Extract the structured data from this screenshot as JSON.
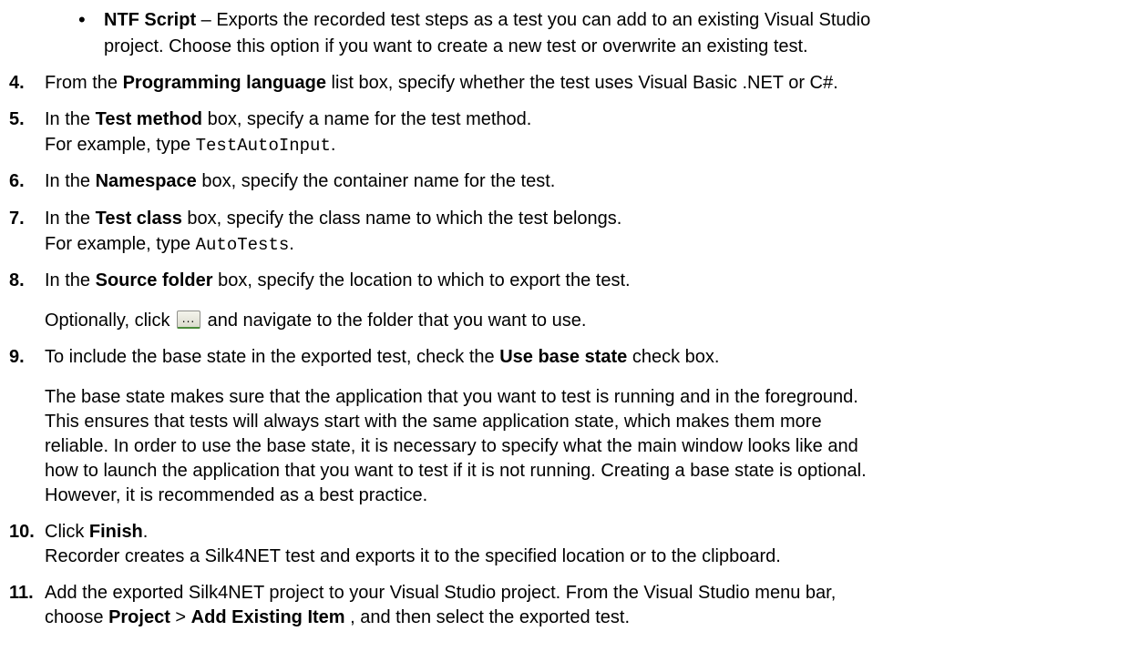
{
  "bullet": {
    "symbol": "•",
    "title": "NTF Script",
    "text1": " – Exports the recorded test steps as a test you can add to an existing Visual Studio",
    "text2": "project. Choose this option if you want to create a new test or overwrite an existing test."
  },
  "step4": {
    "num": "4.",
    "pre": "From the ",
    "bold": "Programming language",
    "post": " list box, specify whether the test uses Visual Basic .NET or C#."
  },
  "step5": {
    "num": "5.",
    "pre": "In the ",
    "bold": "Test method",
    "post": " box, specify a name for the test method.",
    "ex_pre": "For example, type ",
    "ex_code": "TestAutoInput",
    "ex_post": "."
  },
  "step6": {
    "num": "6.",
    "pre": "In the ",
    "bold": "Namespace",
    "post": " box, specify the container name for the test."
  },
  "step7": {
    "num": "7.",
    "pre": "In the ",
    "bold": "Test class",
    "post": " box, specify the class name to which the test belongs.",
    "ex_pre": "For example, type ",
    "ex_code": "AutoTests",
    "ex_post": "."
  },
  "step8": {
    "num": "8.",
    "pre": "In the ",
    "bold": "Source folder",
    "post": " box, specify the location to which to export the test.",
    "opt_pre": "Optionally, click ",
    "opt_btn": "...",
    "opt_post": " and navigate to the folder that you want to use."
  },
  "step9": {
    "num": "9.",
    "pre": "To include the base state in the exported test, check the ",
    "bold": "Use base state",
    "post": " check box.",
    "para": [
      "The base state makes sure that the application that you want to test is running and in the foreground.",
      "This ensures that tests will always start with the same application state, which makes them more",
      "reliable. In order to use the base state, it is necessary to specify what the main window looks like and",
      "how to launch the application that you want to test if it is not running. Creating a base state is optional.",
      "However, it is recommended as a best practice."
    ]
  },
  "step10": {
    "num": "10.",
    "pre": "Click ",
    "bold": "Finish",
    "post": ".",
    "line2": "Recorder creates a Silk4NET test and exports it to the specified location or to the clipboard."
  },
  "step11": {
    "num": "11.",
    "line1": "Add the exported Silk4NET project to your Visual Studio project. From the Visual Studio menu bar,",
    "pre": "choose ",
    "bold1": "Project",
    "mid": " > ",
    "bold2": "Add Existing Item",
    "post": " , and then select the exported test."
  }
}
